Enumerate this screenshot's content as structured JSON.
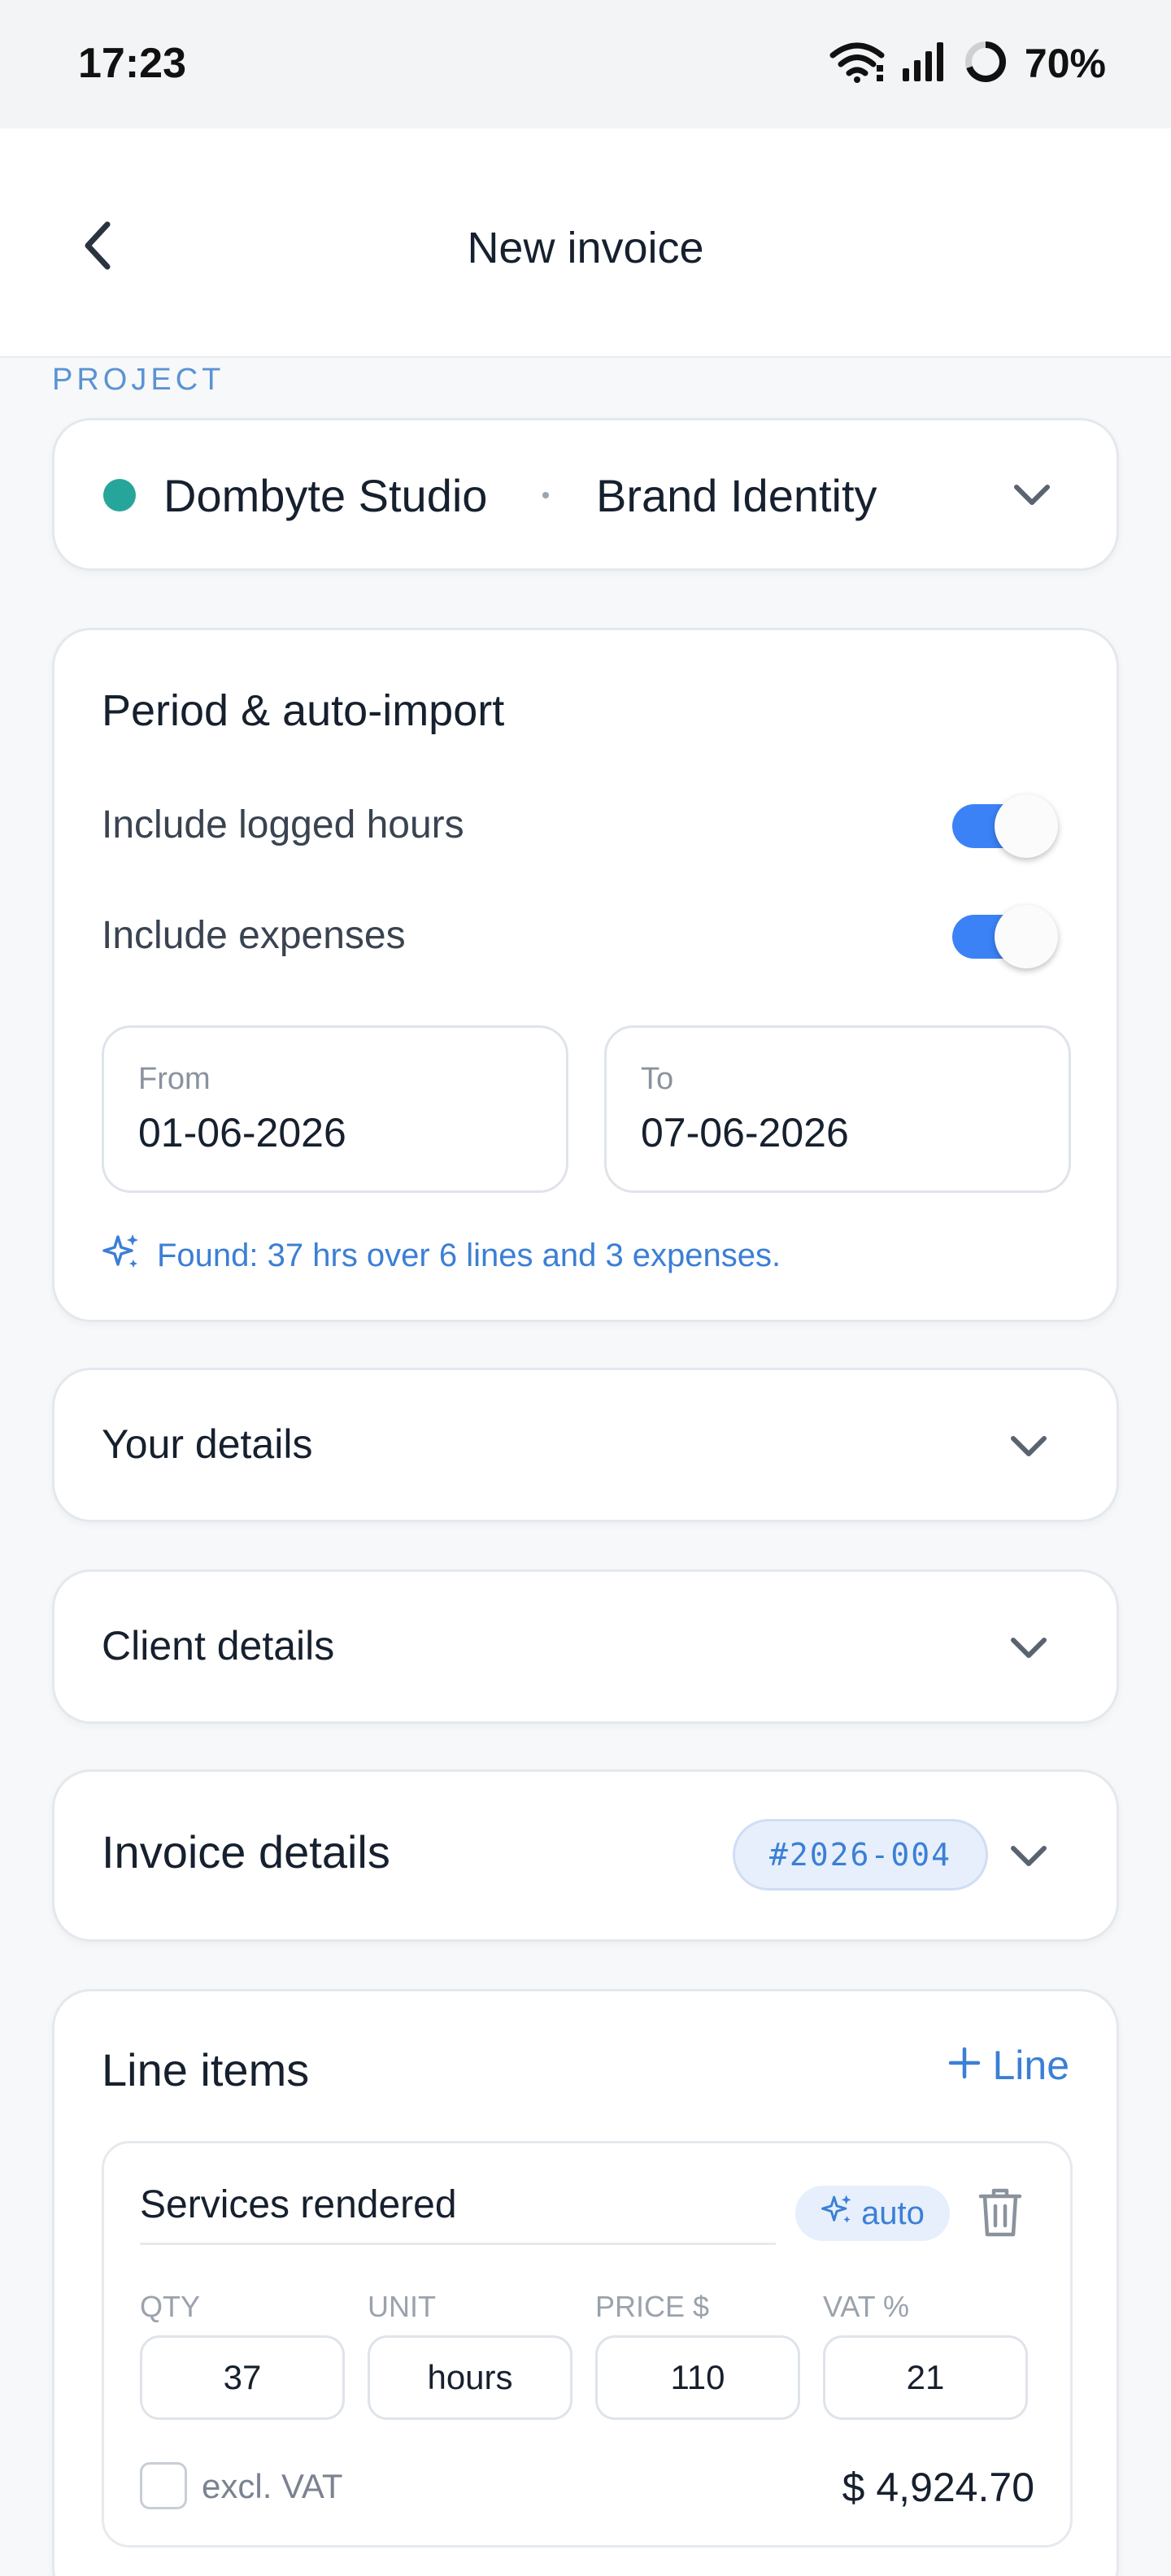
{
  "status_bar": {
    "time": "17:23",
    "battery": "70%",
    "icons": [
      "wifi-icon",
      "signal-icon",
      "battery-ring-icon"
    ]
  },
  "app_bar": {
    "title": "New invoice",
    "back_icon": "chevron-left-icon"
  },
  "project": {
    "section_label": "PROJECT",
    "client": "Dombyte Studio",
    "name": "Brand Identity",
    "dot_color": "#26a69a"
  },
  "period": {
    "title": "Period & auto-import",
    "toggles": [
      {
        "label": "Include logged hours",
        "on": true
      },
      {
        "label": "Include expenses",
        "on": true
      }
    ],
    "from_label": "From",
    "from_value": "01-06-2026",
    "to_label": "To",
    "to_value": "07-06-2026",
    "found_text": "Found: 37 hrs over 6 lines and 3 expenses."
  },
  "sections": {
    "your_details": "Your details",
    "client_details": "Client details",
    "invoice_details": "Invoice details",
    "invoice_number": "#2026-004"
  },
  "line_items": {
    "title": "Line items",
    "add_label": "Line",
    "items": [
      {
        "description": "Services rendered",
        "auto_label": "auto",
        "qty_label": "QTY",
        "unit_label": "UNIT",
        "price_label": "PRICE $",
        "vat_label": "VAT %",
        "qty": "37",
        "unit": "hours",
        "price": "110",
        "vat": "21",
        "excl_vat_label": "excl. VAT",
        "total": "$ 4,924.70"
      }
    ]
  },
  "colors": {
    "accent": "#3b7fd6",
    "toggle_on": "#3b82f6",
    "project_dot": "#26a69a"
  }
}
